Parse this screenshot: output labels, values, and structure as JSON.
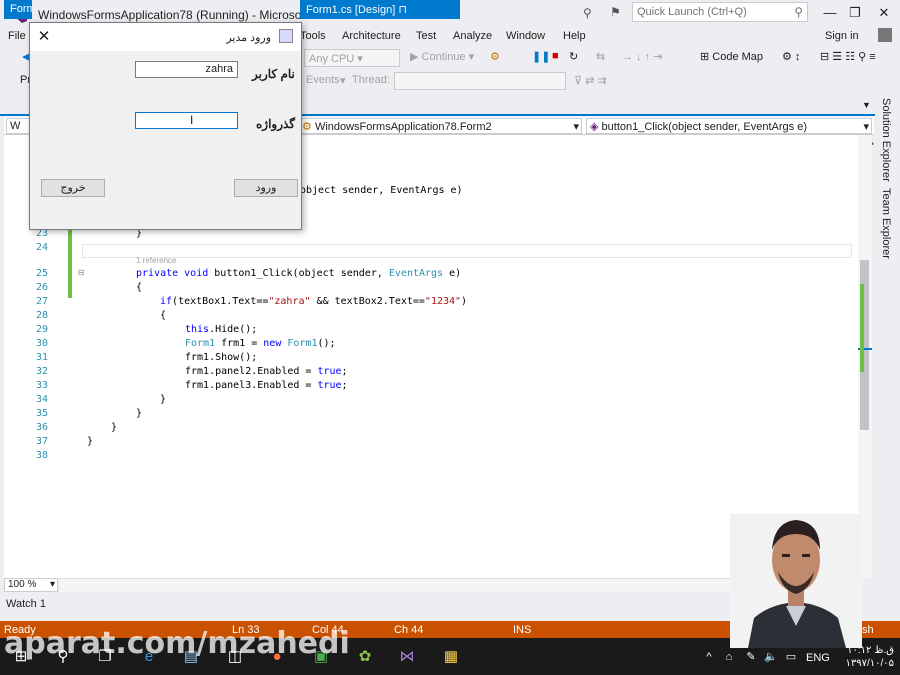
{
  "window": {
    "title": "WindowsFormsApplication78 (Running) - Microsoft Visual Studio",
    "quick_launch_placeholder": "Quick Launch (Ctrl+Q)",
    "sign_in": "Sign in"
  },
  "menu": [
    "File",
    "Tools",
    "Architecture",
    "Test",
    "Analyze",
    "Window",
    "Help"
  ],
  "toolbar": {
    "platform": "Any CPU",
    "continue": "Continue",
    "code_map": "Code Map",
    "events": "Events",
    "thread": "Thread:",
    "pr_label": "Pr"
  },
  "tabs": {
    "left_tab": "Form",
    "design_tab": "Form1.cs [Design]"
  },
  "navbar": {
    "left_combo": "W",
    "class_combo": "WindowsFormsApplication78.Form2",
    "member_combo": "button1_Click(object sender, EventArgs e)"
  },
  "code": {
    "line_numbers": [
      "23",
      "24",
      "25",
      "26",
      "27",
      "28",
      "29",
      "30",
      "31",
      "32",
      "33",
      "34",
      "35",
      "36",
      "37",
      "38"
    ],
    "reference_hint": "1 reference",
    "partial_line": "object sender, EventArgs e)",
    "lines": {
      "l23": "}",
      "l25_kw": "private void ",
      "l25_rest": "button1_Click(object sender, ",
      "l25_type": "EventArgs",
      "l25_end": " e)",
      "l26": "{",
      "l27_kw": "if",
      "l27_a": "(textBox1.Text==",
      "l27_s1": "\"zahra\"",
      "l27_b": " && textBox2.Text==",
      "l27_s2": "\"1234\"",
      "l27_c": ")",
      "l28": "{",
      "l29_kw": "this",
      "l29_rest": ".Hide();",
      "l30_type": "Form1",
      "l30_a": " frm1 = ",
      "l30_kw": "new",
      "l30_sp": " ",
      "l30_type2": "Form1",
      "l30_b": "();",
      "l31": "frm1.Show();",
      "l32_a": "frm1.panel2.Enabled = ",
      "l32_kw": "true",
      "l32_b": ";",
      "l33_a": "frm1.panel3.Enabled = ",
      "l33_kw": "true",
      "l33_b": ";",
      "l34": "}",
      "l35": "}",
      "l36": "}",
      "l37": "}"
    }
  },
  "side_panels": [
    "Solution Explorer",
    "Team Explorer"
  ],
  "zoom": "100 %",
  "watch": "Watch 1",
  "status": {
    "state": "Ready",
    "line": "Ln 33",
    "col": "Col 44",
    "ch": "Ch 44",
    "mode": "INS",
    "publish_tail": "sh"
  },
  "taskbar": {
    "lang": "ENG",
    "time": "ق.ظ ۱۰:۱۲",
    "date": "۱۳۹۷/۱۰/۰۵"
  },
  "watermark": "aparat.com/mzahedi",
  "dialog": {
    "title": "ورود مدیر",
    "username_label": "نام کاربر",
    "username_value": "zahra",
    "password_label": "گذرواژه",
    "password_value": "",
    "exit_button": "خروج",
    "login_button": "ورود"
  },
  "colors": {
    "accent": "#007acc",
    "status_bar": "#ca5100",
    "keyword": "#0000ff",
    "type": "#2b91af",
    "string": "#a31515"
  }
}
